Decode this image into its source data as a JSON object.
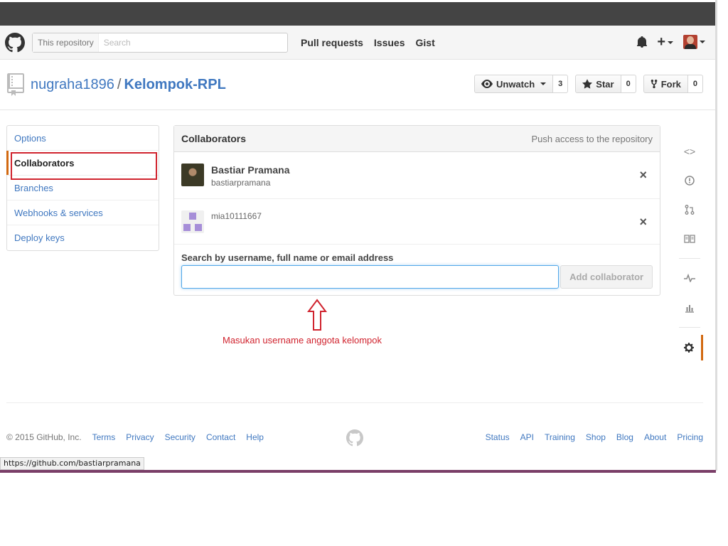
{
  "header": {
    "search_scope": "This repository",
    "search_placeholder": "Search",
    "nav": [
      "Pull requests",
      "Issues",
      "Gist"
    ]
  },
  "repo": {
    "owner": "nugraha1896",
    "separator": "/",
    "name": "Kelompok-RPL",
    "unwatch_label": "Unwatch",
    "watch_count": "3",
    "star_label": "Star",
    "star_count": "0",
    "fork_label": "Fork",
    "fork_count": "0"
  },
  "settings_menu": {
    "items": [
      "Options",
      "Collaborators",
      "Branches",
      "Webhooks & services",
      "Deploy keys"
    ],
    "selected": "Collaborators"
  },
  "collaborators": {
    "title": "Collaborators",
    "note": "Push access to the repository",
    "list": [
      {
        "name": "Bastiar Pramana",
        "login": "bastiarpramana"
      },
      {
        "login": "mia10111667"
      }
    ],
    "remove_icon": "×",
    "add_label": "Search by username, full name or email address",
    "add_value": "",
    "add_button": "Add collaborator"
  },
  "annotation": {
    "text": "Masukan username anggota kelompok",
    "color": "#d0232e"
  },
  "footer": {
    "copyright": "© 2015 GitHub, Inc.",
    "left_links": [
      "Terms",
      "Privacy",
      "Security",
      "Contact",
      "Help"
    ],
    "right_links": [
      "Status",
      "API",
      "Training",
      "Shop",
      "Blog",
      "About",
      "Pricing"
    ]
  },
  "statusbar": {
    "url": "https://github.com/bastiarpramana"
  },
  "colors": {
    "link": "#4078c0",
    "accent": "#d26911",
    "focus": "#51a7e8"
  }
}
